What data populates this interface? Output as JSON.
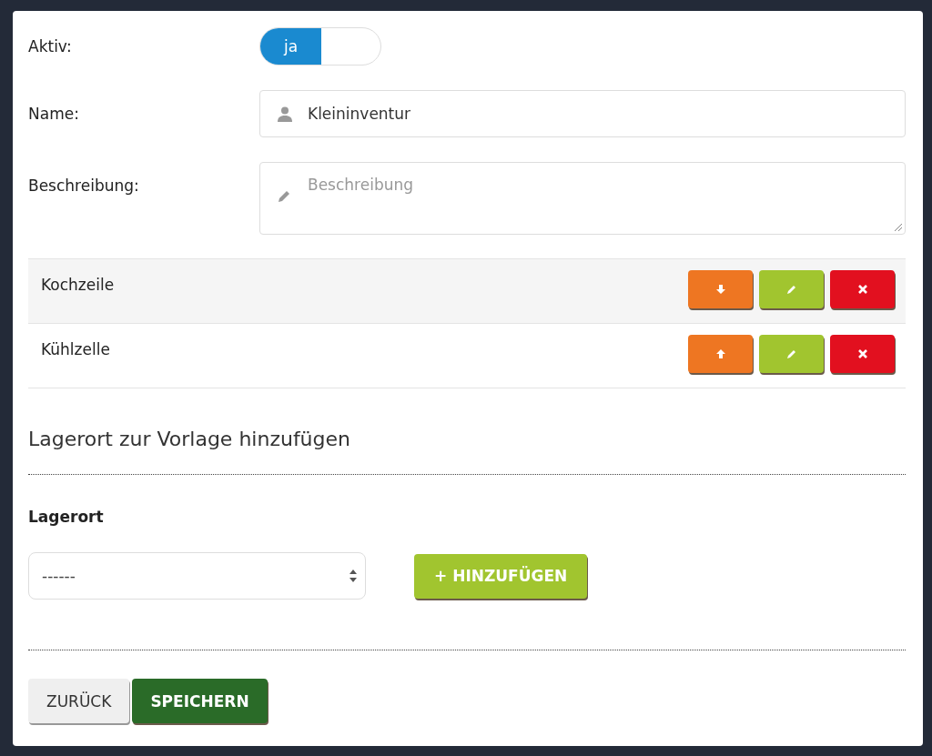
{
  "form": {
    "active": {
      "label": "Aktiv:",
      "toggle": {
        "text": "ja",
        "on": true
      }
    },
    "name": {
      "label": "Name:",
      "value": "Kleininventur"
    },
    "description": {
      "label": "Beschreibung:",
      "placeholder": "Beschreibung"
    }
  },
  "locations": [
    {
      "name": "Kochzeile",
      "buttons": [
        {
          "kind": "down"
        },
        {
          "kind": "edit"
        },
        {
          "kind": "delete"
        }
      ]
    },
    {
      "name": "Kühlzelle",
      "buttons": [
        {
          "kind": "up"
        },
        {
          "kind": "edit"
        },
        {
          "kind": "delete"
        }
      ]
    }
  ],
  "add_section": {
    "heading": "Lagerort zur Vorlage hinzufügen",
    "field_label": "Lagerort",
    "select_value": "------",
    "add_button": "+ HINZUFÜGEN"
  },
  "footer_buttons": [
    {
      "kind": "back",
      "label": "ZURÜCK"
    },
    {
      "kind": "save",
      "label": "SPEICHERN"
    }
  ]
}
